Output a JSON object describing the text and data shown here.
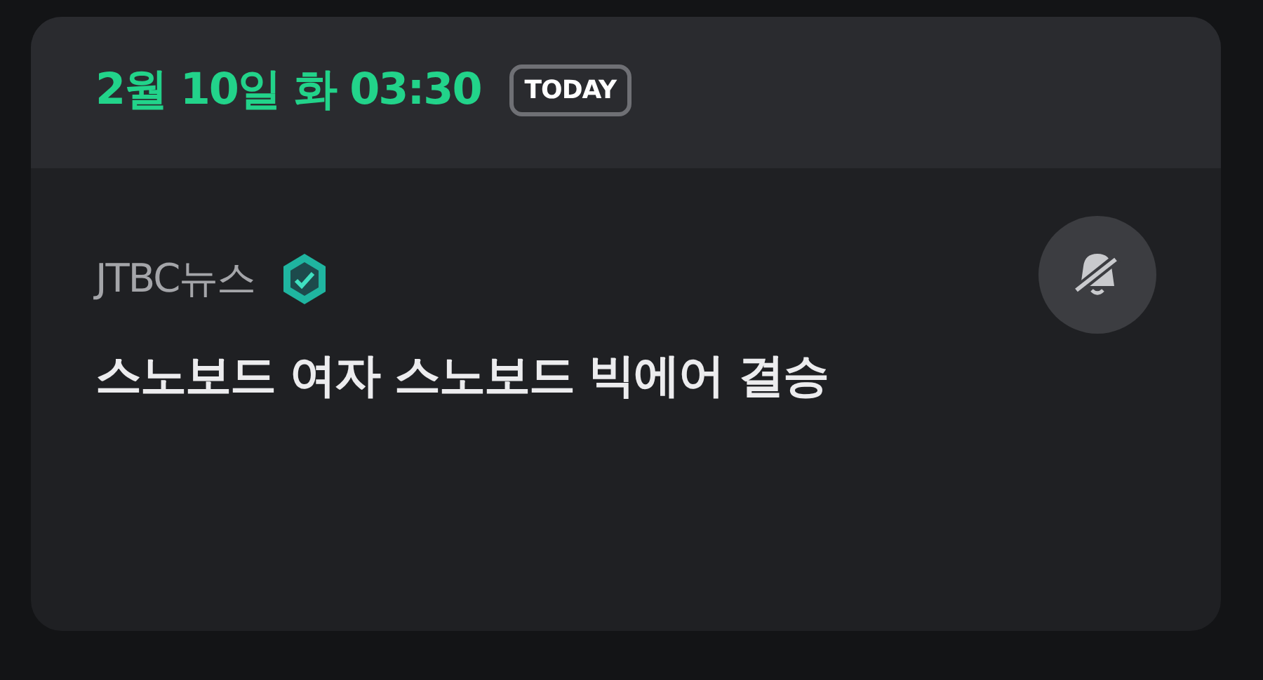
{
  "header": {
    "date": "2월 10일 화 03:30",
    "badge": "TODAY"
  },
  "item": {
    "source": "JTBC뉴스",
    "verified": true,
    "title": "스노보드 여자 스노보드 빅에어 결승",
    "alert_muted": true
  }
}
